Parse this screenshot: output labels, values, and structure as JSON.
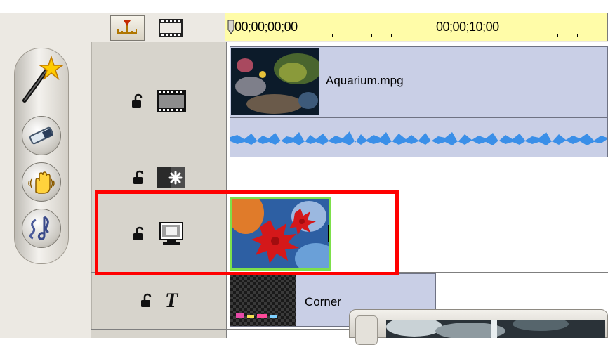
{
  "toolbar": {
    "timeline_view_icon": "timeline-view-icon",
    "storyboard_view_icon": "storyboard-view-icon"
  },
  "ruler": {
    "timecode_start": "00;00;00;00",
    "timecode_mid": "00;00;10;00"
  },
  "palette": {
    "tools": [
      "magic-wand-icon",
      "trim-icon",
      "hand-icon",
      "music-icon"
    ]
  },
  "tracks": [
    {
      "name": "video-track",
      "icon": "film-icon",
      "locked": false
    },
    {
      "name": "effect-track",
      "icon": "transition-icon",
      "locked": false
    },
    {
      "name": "overlay-track",
      "icon": "monitor-icon",
      "locked": false
    },
    {
      "name": "title-track",
      "icon": "title-t-icon",
      "locked": false
    }
  ],
  "clips": {
    "video": {
      "label": "Aquarium.mpg"
    },
    "title": {
      "label": "Corner"
    }
  },
  "title_track_symbol": "T",
  "colors": {
    "highlight": "#ff0000",
    "clip_fill": "#c9cfe6",
    "audio_wave": "#3a8fe8",
    "ruler": "#fffca8",
    "overlay_border": "#7de04a"
  }
}
